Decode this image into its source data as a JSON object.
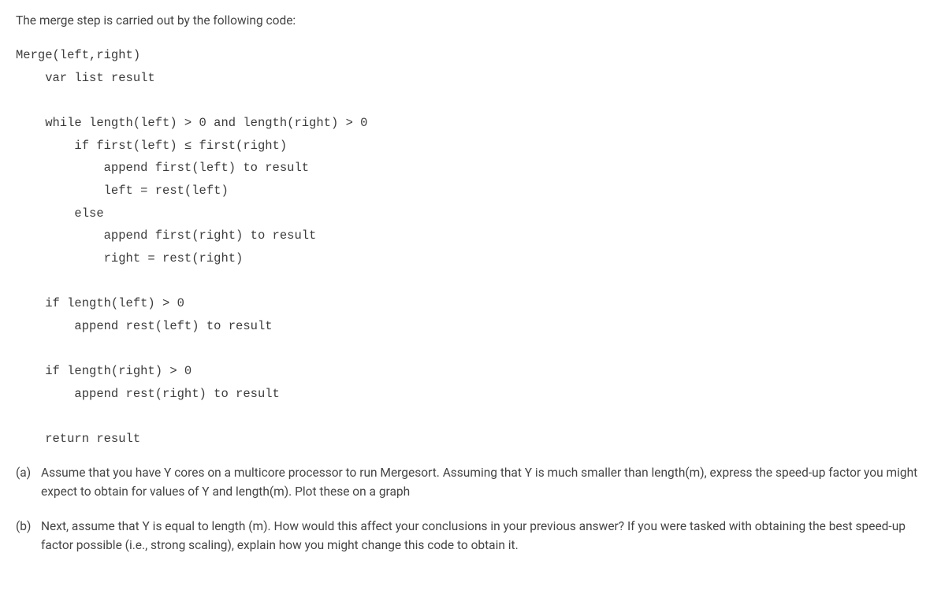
{
  "intro": "The merge step is carried out by the following code:",
  "code": "Merge(left,right)\n    var list result\n\n    while length(left) > 0 and length(right) > 0\n        if first(left) ≤ first(right)\n            append first(left) to result\n            left = rest(left)\n        else\n            append first(right) to result\n            right = rest(right)\n\n    if length(left) > 0\n        append rest(left) to result\n\n    if length(right) > 0\n        append rest(right) to result\n\n    return result",
  "questions": [
    {
      "label": "(a)",
      "text": "Assume that you have Y cores on a multicore processor to run Mergesort. Assuming that Y is much smaller than length(m), express the speed-up factor you might expect to obtain for values of Y and length(m). Plot these on a graph"
    },
    {
      "label": "(b)",
      "text": "Next, assume that Y is equal to length (m). How would this affect your conclusions in your previous answer? If you were tasked with obtaining the best speed-up factor possible (i.e., strong scaling), explain how you might change this code to obtain it."
    }
  ]
}
